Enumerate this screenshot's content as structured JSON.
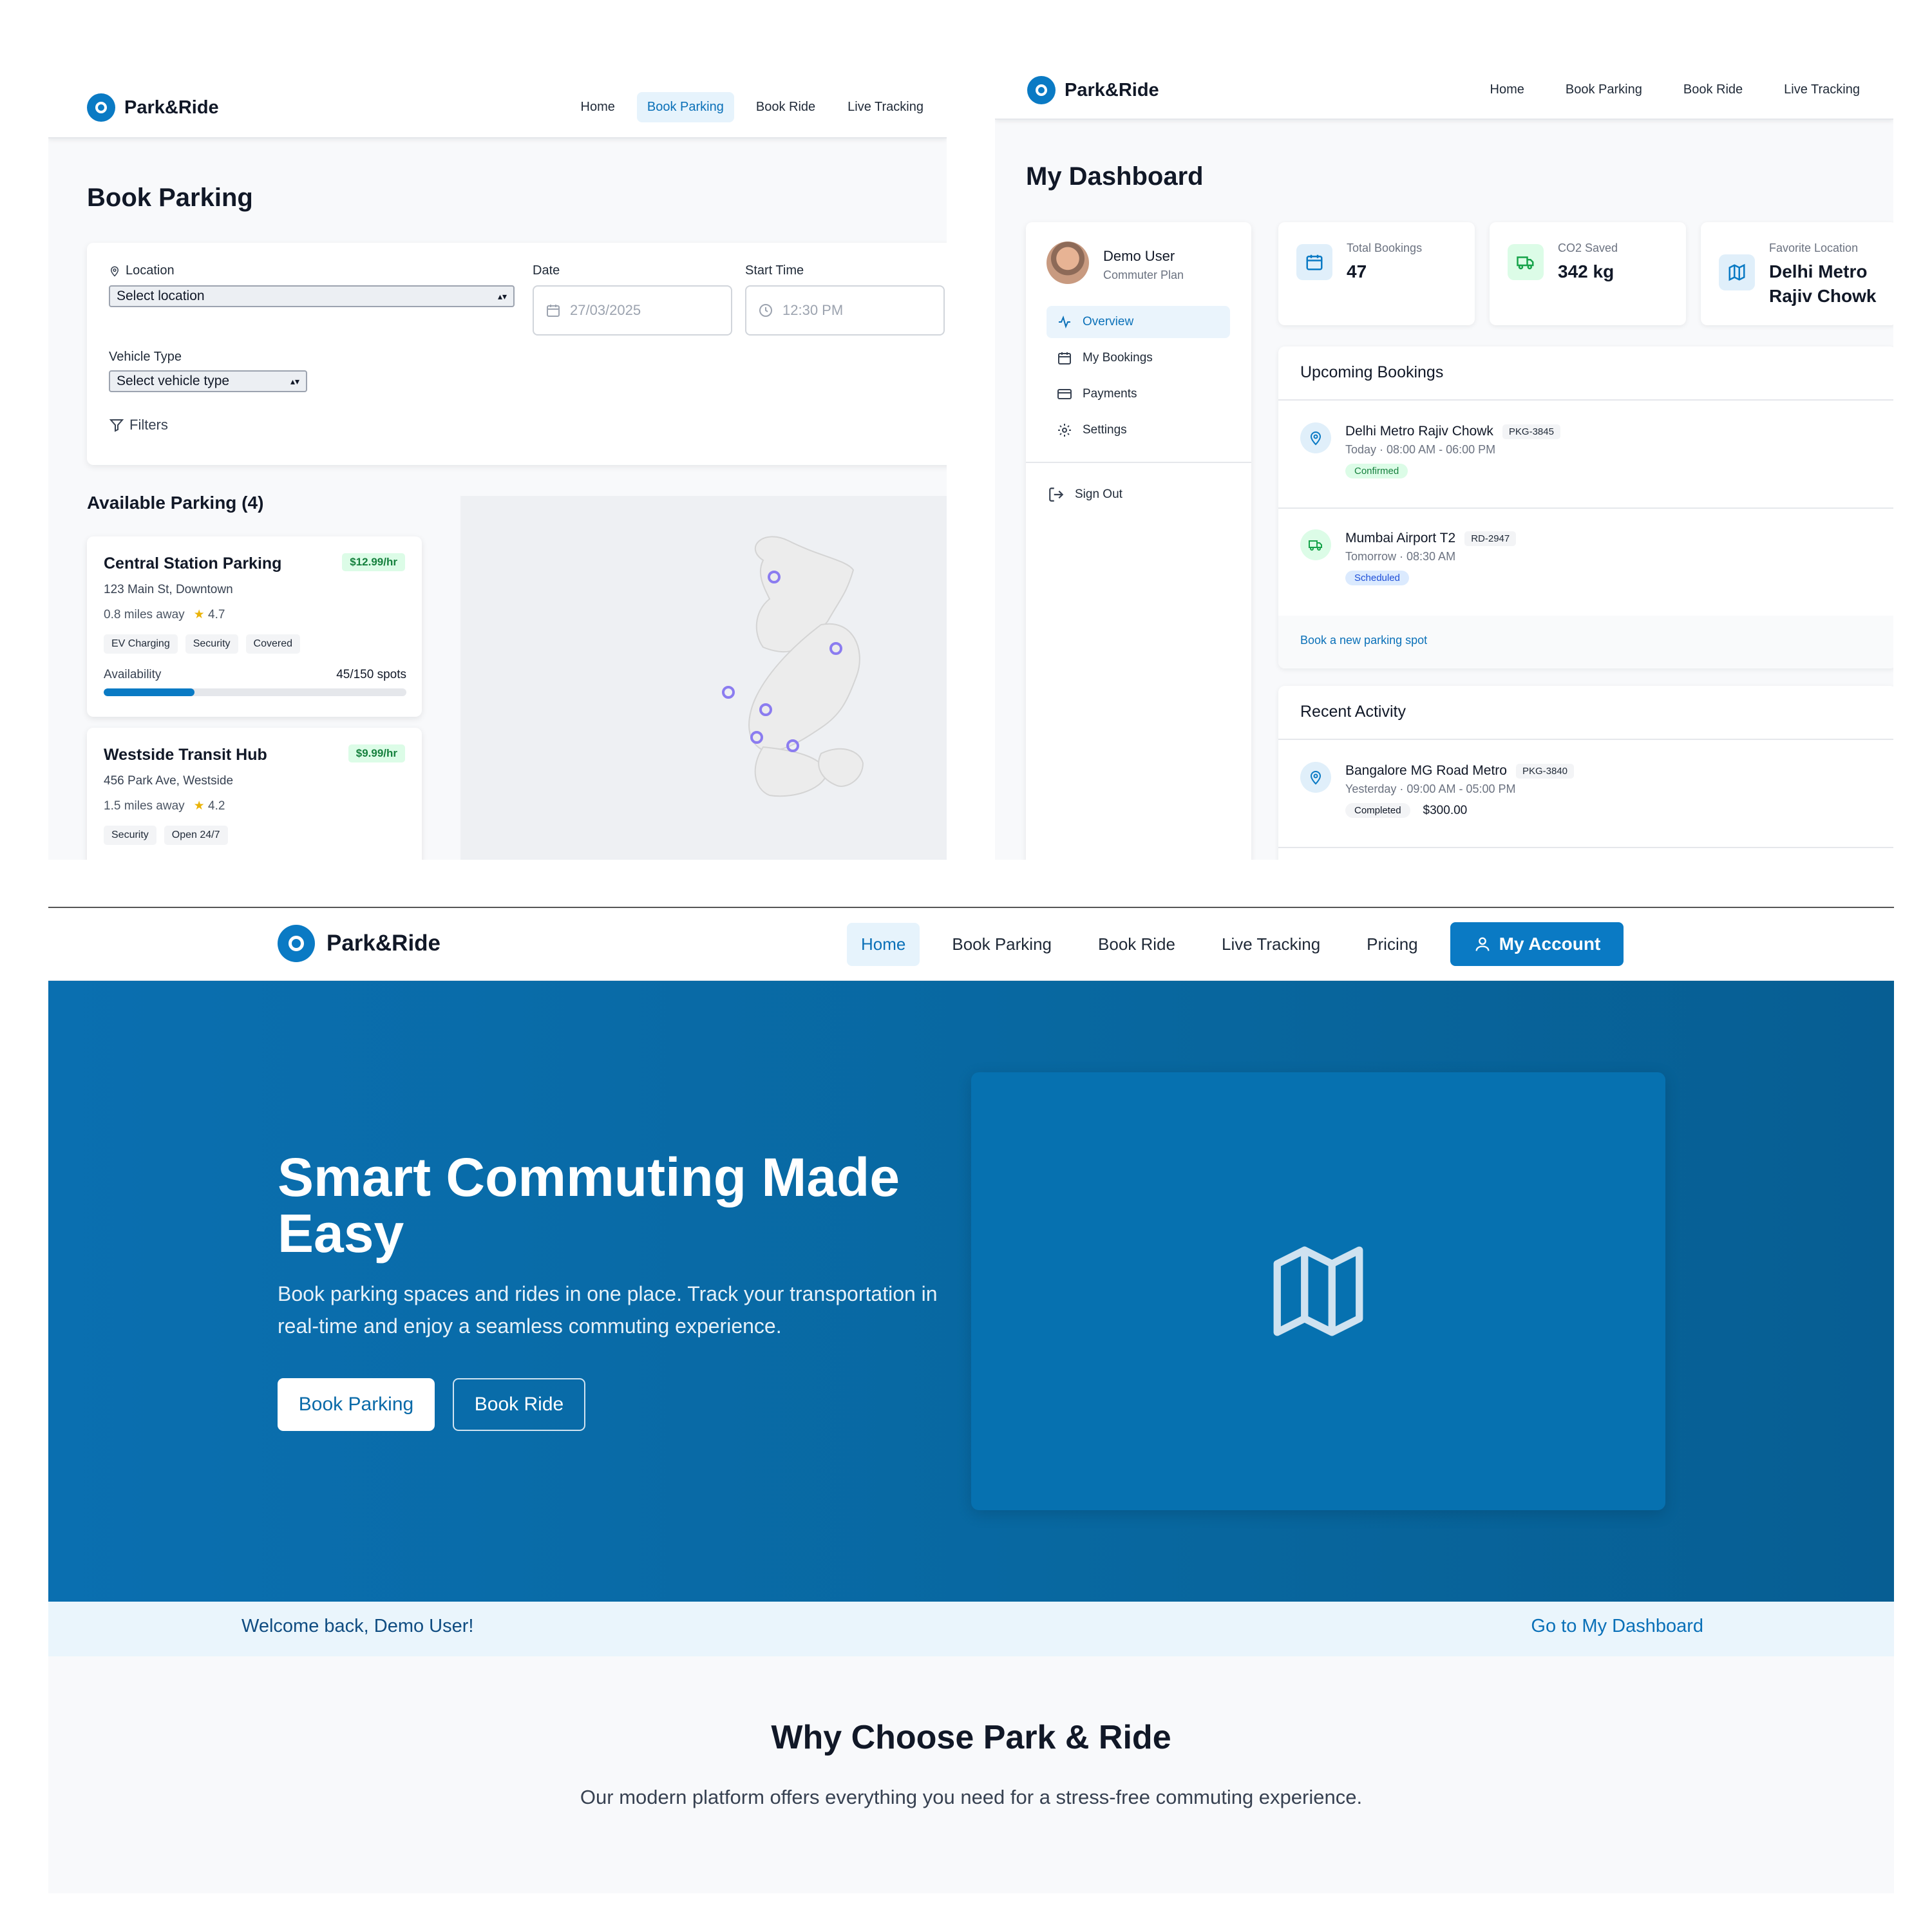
{
  "brand": "Park&Ride",
  "colors": {
    "primary": "#0a7ac4",
    "hero_bg": "#08679f",
    "success": "#15803d",
    "muted": "#6b7280"
  },
  "booking_page": {
    "nav": [
      {
        "label": "Home",
        "active": false
      },
      {
        "label": "Book Parking",
        "active": true
      },
      {
        "label": "Book Ride",
        "active": false
      },
      {
        "label": "Live Tracking",
        "active": false
      }
    ],
    "title": "Book Parking",
    "form": {
      "location_label": "Location",
      "location_value": "Select location",
      "date_label": "Date",
      "date_value": "27/03/2025",
      "start_time_label": "Start Time",
      "start_time_value": "12:30 PM",
      "vehicle_type_label": "Vehicle Type",
      "vehicle_type_value": "Select vehicle type",
      "filters_label": "Filters"
    },
    "available_title": "Available Parking (4)",
    "lots": [
      {
        "name": "Central Station Parking",
        "price": "$12.99/hr",
        "address": "123 Main St, Downtown",
        "distance": "0.8 miles away",
        "rating": "4.7",
        "tags": [
          "EV Charging",
          "Security",
          "Covered"
        ],
        "availability_label": "Availability",
        "spots": "45/150 spots",
        "fill_fraction": 0.3
      },
      {
        "name": "Westside Transit Hub",
        "price": "$9.99/hr",
        "address": "456 Park Ave, Westside",
        "distance": "1.5 miles away",
        "rating": "4.2",
        "tags": [
          "Security",
          "Open 24/7"
        ]
      }
    ]
  },
  "dashboard_page": {
    "nav": [
      "Home",
      "Book Parking",
      "Book Ride",
      "Live Tracking"
    ],
    "title": "My Dashboard",
    "user": {
      "name": "Demo User",
      "plan": "Commuter Plan"
    },
    "menu": [
      {
        "label": "Overview",
        "icon": "activity-icon",
        "active": true
      },
      {
        "label": "My Bookings",
        "icon": "calendar-icon",
        "active": false
      },
      {
        "label": "Payments",
        "icon": "credit-card-icon",
        "active": false
      },
      {
        "label": "Settings",
        "icon": "gear-icon",
        "active": false
      }
    ],
    "sign_out": "Sign Out",
    "stats": [
      {
        "label": "Total Bookings",
        "value": "47",
        "icon": "calendar-icon"
      },
      {
        "label": "CO2 Saved",
        "value": "342 kg",
        "icon": "truck-icon"
      },
      {
        "label": "Favorite Location",
        "value": "Delhi Metro Rajiv Chowk",
        "icon": "map-icon"
      }
    ],
    "upcoming_title": "Upcoming Bookings",
    "upcoming": [
      {
        "name": "Delhi Metro Rajiv Chowk",
        "code": "PKG-3845",
        "time": "Today · 08:00 AM - 06:00 PM",
        "status": "Confirmed",
        "icon": "map-pin-icon"
      },
      {
        "name": "Mumbai Airport T2",
        "code": "RD-2947",
        "time": "Tomorrow · 08:30 AM",
        "status": "Scheduled",
        "icon": "truck-icon"
      }
    ],
    "new_booking_link": "Book a new parking spot",
    "recent_title": "Recent Activity",
    "recent": [
      {
        "name": "Bangalore MG Road Metro",
        "code": "PKG-3840",
        "time": "Yesterday · 09:00 AM - 05:00 PM",
        "status": "Completed",
        "amount": "$300.00",
        "icon": "map-pin-icon"
      }
    ]
  },
  "home_page": {
    "nav": [
      {
        "label": "Home",
        "active": true
      },
      {
        "label": "Book Parking",
        "active": false
      },
      {
        "label": "Book Ride",
        "active": false
      },
      {
        "label": "Live Tracking",
        "active": false
      },
      {
        "label": "Pricing",
        "active": false
      }
    ],
    "account_button": "My Account",
    "hero": {
      "title": "Smart Commuting Made Easy",
      "subtitle": "Book parking spaces and rides in one place. Track your transportation in real-time and enjoy a seamless commuting experience.",
      "primary_button": "Book Parking",
      "secondary_button": "Book Ride",
      "image_icon": "map-icon"
    },
    "welcome_text": "Welcome back, Demo User!",
    "dashboard_link": "Go to My Dashboard",
    "why_title": "Why Choose Park & Ride",
    "why_subtitle": "Our modern platform offers everything you need for a stress-free commuting experience."
  }
}
